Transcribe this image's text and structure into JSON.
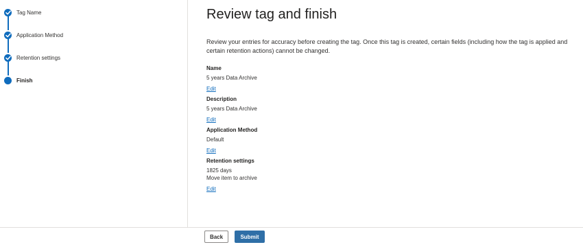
{
  "steps": [
    {
      "label": "Tag Name",
      "state": "completed"
    },
    {
      "label": "Application Method",
      "state": "completed"
    },
    {
      "label": "Retention settings",
      "state": "completed"
    },
    {
      "label": "Finish",
      "state": "current"
    }
  ],
  "main": {
    "title": "Review tag and finish",
    "intro": "Review your entries for accuracy before creating the tag. Once this tag is created, certain fields (including how the tag is applied and certain retention actions) cannot be changed.",
    "sections": [
      {
        "heading": "Name",
        "values": [
          "5 years Data Archive"
        ],
        "edit_label": "Edit"
      },
      {
        "heading": "Description",
        "values": [
          "5 years Data Archive"
        ],
        "edit_label": "Edit"
      },
      {
        "heading": "Application Method",
        "values": [
          "Default"
        ],
        "edit_label": "Edit"
      },
      {
        "heading": "Retention settings",
        "values": [
          "1825 days",
          "Move item to archive"
        ],
        "edit_label": "Edit"
      }
    ]
  },
  "footer": {
    "back_label": "Back",
    "submit_label": "Submit"
  },
  "colors": {
    "accent": "#0f6cbd",
    "primary_button": "#2f6fa7"
  },
  "icons": {
    "completed_step": "checkmark-icon",
    "current_step": "current-step-dot-icon"
  }
}
